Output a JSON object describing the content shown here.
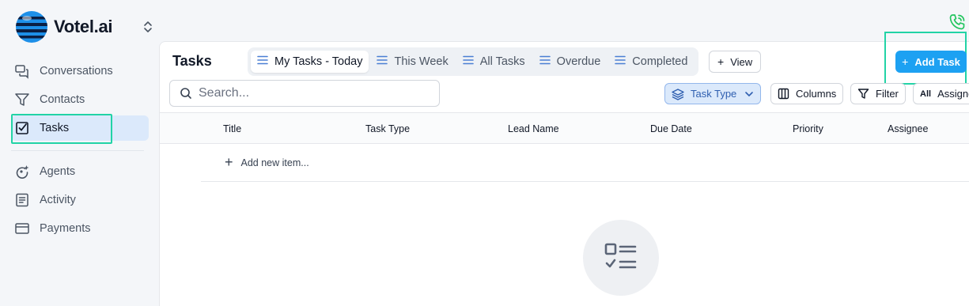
{
  "brand": {
    "name": "Votel.ai",
    "logo_icon": "globe-logo-icon"
  },
  "sidebar": {
    "items": [
      {
        "label": "Conversations",
        "icon": "chat-bubbles-icon"
      },
      {
        "label": "Contacts",
        "icon": "funnel-icon"
      },
      {
        "label": "Tasks",
        "icon": "checkbox-icon",
        "active": true
      },
      {
        "label": "Agents",
        "icon": "agent-sparkle-icon"
      },
      {
        "label": "Activity",
        "icon": "list-doc-icon"
      },
      {
        "label": "Payments",
        "icon": "card-icon"
      }
    ]
  },
  "header": {
    "title": "Tasks",
    "tabs": [
      {
        "label": "My Tasks - Today",
        "active": true
      },
      {
        "label": "This Week"
      },
      {
        "label": "All Tasks"
      },
      {
        "label": "Overdue"
      },
      {
        "label": "Completed"
      }
    ],
    "view_label": "View",
    "add_task_label": "Add Task"
  },
  "toolbar": {
    "search_placeholder": "Search...",
    "task_type_label": "Task Type",
    "columns_label": "Columns",
    "filter_label": "Filter",
    "assignee_prefix": "All",
    "assignee_label": "Assignee"
  },
  "table": {
    "columns": [
      "Title",
      "Task Type",
      "Lead Name",
      "Due Date",
      "Priority",
      "Assignee"
    ],
    "add_item_label": "Add new item..."
  },
  "empty_state": {
    "icon": "task-checklist-icon"
  },
  "colors": {
    "accent": "#1da1f2",
    "highlight": "#22d3a6",
    "tab_icon": "#4a7fd4",
    "phone": "#22c55e"
  }
}
